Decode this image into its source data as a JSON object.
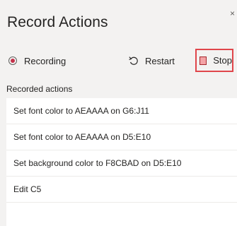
{
  "panel": {
    "title": "Record Actions",
    "close_glyph": "×"
  },
  "toolbar": {
    "recording_label": "Recording",
    "restart_label": "Restart",
    "stop_label": "Stop"
  },
  "recorded": {
    "heading": "Recorded actions",
    "items": [
      "Set font color to AEAAAA on G6:J11",
      "Set font color to AEAAAA on D5:E10",
      "Set background color to F8CBAD on D5:E10",
      "Edit C5"
    ]
  },
  "colors": {
    "stop_highlight_border": "#e0464b",
    "stop_icon_fill": "#f3a3a6",
    "recording_dot": "#c4314b"
  },
  "icons": {
    "recording": "record-circle-icon",
    "restart": "restart-arrow-icon",
    "stop": "stop-square-icon",
    "close": "close-icon"
  }
}
